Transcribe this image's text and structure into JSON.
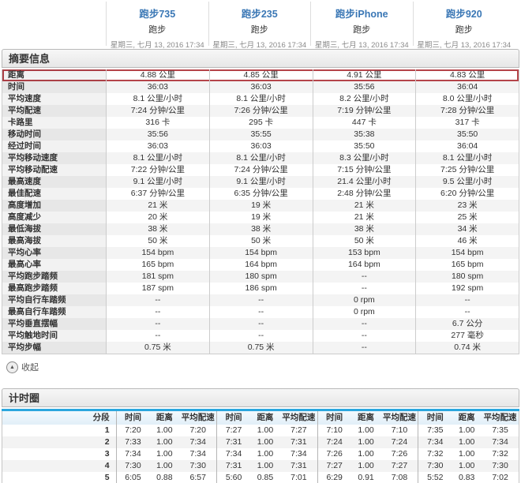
{
  "devices": [
    {
      "name": "跑步735",
      "type": "跑步",
      "date": "星期三, 七月 13, 2016 17:34"
    },
    {
      "name": "跑步235",
      "type": "跑步",
      "date": "星期三, 七月 13, 2016 17:34"
    },
    {
      "name": "跑步iPhone",
      "type": "跑步",
      "date": "星期三, 七月 13, 2016 17:34"
    },
    {
      "name": "跑步920",
      "type": "跑步",
      "date": "星期三, 七月 13, 2016 17:34"
    }
  ],
  "summary": {
    "title": "摘要信息",
    "collapse_label": "收起",
    "collapse_icon": "▲",
    "rows": [
      {
        "label": "距离",
        "values": [
          "4.88 公里",
          "4.85 公里",
          "4.91 公里",
          "4.83 公里"
        ],
        "highlighted": true
      },
      {
        "label": "时间",
        "values": [
          "36:03",
          "36:03",
          "35:56",
          "36:04"
        ]
      },
      {
        "label": "平均速度",
        "values": [
          "8.1 公里/小时",
          "8.1 公里/小时",
          "8.2 公里/小时",
          "8.0 公里/小时"
        ]
      },
      {
        "label": "平均配速",
        "values": [
          "7:24 分钟/公里",
          "7:26 分钟/公里",
          "7:19 分钟/公里",
          "7:28 分钟/公里"
        ]
      },
      {
        "label": "卡路里",
        "values": [
          "316 卡",
          "295 卡",
          "447 卡",
          "317 卡"
        ]
      },
      {
        "label": "移动时间",
        "values": [
          "35:56",
          "35:55",
          "35:38",
          "35:50"
        ]
      },
      {
        "label": "经过时间",
        "values": [
          "36:03",
          "36:03",
          "35:50",
          "36:04"
        ]
      },
      {
        "label": "平均移动速度",
        "values": [
          "8.1 公里/小时",
          "8.1 公里/小时",
          "8.3 公里/小时",
          "8.1 公里/小时"
        ]
      },
      {
        "label": "平均移动配速",
        "values": [
          "7:22 分钟/公里",
          "7:24 分钟/公里",
          "7:15 分钟/公里",
          "7:25 分钟/公里"
        ]
      },
      {
        "label": "最高速度",
        "values": [
          "9.1 公里/小时",
          "9.1 公里/小时",
          "21.4 公里/小时",
          "9.5 公里/小时"
        ]
      },
      {
        "label": "最佳配速",
        "values": [
          "6:37 分钟/公里",
          "6:35 分钟/公里",
          "2:48 分钟/公里",
          "6:20 分钟/公里"
        ]
      },
      {
        "label": "高度增加",
        "values": [
          "21 米",
          "19 米",
          "21 米",
          "23 米"
        ]
      },
      {
        "label": "高度减少",
        "values": [
          "20 米",
          "19 米",
          "21 米",
          "25 米"
        ]
      },
      {
        "label": "最低海拔",
        "values": [
          "38 米",
          "38 米",
          "38 米",
          "34 米"
        ]
      },
      {
        "label": "最高海拔",
        "values": [
          "50 米",
          "50 米",
          "50 米",
          "46 米"
        ]
      },
      {
        "label": "平均心率",
        "values": [
          "154 bpm",
          "154 bpm",
          "153 bpm",
          "154 bpm"
        ]
      },
      {
        "label": "最高心率",
        "values": [
          "165 bpm",
          "164 bpm",
          "164 bpm",
          "165 bpm"
        ]
      },
      {
        "label": "平均跑步踏频",
        "values": [
          "181 spm",
          "180 spm",
          "--",
          "180 spm"
        ]
      },
      {
        "label": "最高跑步踏频",
        "values": [
          "187 spm",
          "186 spm",
          "--",
          "192 spm"
        ]
      },
      {
        "label": "平均自行车踏频",
        "values": [
          "--",
          "--",
          "0 rpm",
          "--"
        ]
      },
      {
        "label": "最高自行车踏频",
        "values": [
          "--",
          "--",
          "0 rpm",
          "--"
        ]
      },
      {
        "label": "平均垂直摆幅",
        "values": [
          "--",
          "--",
          "--",
          "6.7 公分"
        ]
      },
      {
        "label": "平均触地时间",
        "values": [
          "--",
          "--",
          "--",
          "277 毫秒"
        ]
      },
      {
        "label": "平均步幅",
        "values": [
          "0.75 米",
          "0.75 米",
          "--",
          "0.74 米"
        ]
      }
    ]
  },
  "laps": {
    "title": "计时圈",
    "headers": {
      "segment": "分段",
      "time": "时间",
      "distance": "距离",
      "pace": "平均配速"
    },
    "rows": [
      {
        "segment": "1",
        "groups": [
          [
            "7:20",
            "1.00",
            "7:20"
          ],
          [
            "7:27",
            "1.00",
            "7:27"
          ],
          [
            "7:10",
            "1.00",
            "7:10"
          ],
          [
            "7:35",
            "1.00",
            "7:35"
          ]
        ]
      },
      {
        "segment": "2",
        "groups": [
          [
            "7:33",
            "1.00",
            "7:34"
          ],
          [
            "7:31",
            "1.00",
            "7:31"
          ],
          [
            "7:24",
            "1.00",
            "7:24"
          ],
          [
            "7:34",
            "1.00",
            "7:34"
          ]
        ]
      },
      {
        "segment": "3",
        "groups": [
          [
            "7:34",
            "1.00",
            "7:34"
          ],
          [
            "7:34",
            "1.00",
            "7:34"
          ],
          [
            "7:26",
            "1.00",
            "7:26"
          ],
          [
            "7:32",
            "1.00",
            "7:32"
          ]
        ]
      },
      {
        "segment": "4",
        "groups": [
          [
            "7:30",
            "1.00",
            "7:30"
          ],
          [
            "7:31",
            "1.00",
            "7:31"
          ],
          [
            "7:27",
            "1.00",
            "7:27"
          ],
          [
            "7:30",
            "1.00",
            "7:30"
          ]
        ]
      },
      {
        "segment": "5",
        "groups": [
          [
            "6:05",
            "0.88",
            "6:57"
          ],
          [
            "5:60",
            "0.85",
            "7:01"
          ],
          [
            "6:29",
            "0.91",
            "7:08"
          ],
          [
            "5:52",
            "0.83",
            "7:02"
          ]
        ]
      }
    ]
  },
  "colors": {
    "link_blue": "#3a77b5",
    "highlight_red": "#b5444a",
    "accent_cyan": "#2ba7de"
  }
}
